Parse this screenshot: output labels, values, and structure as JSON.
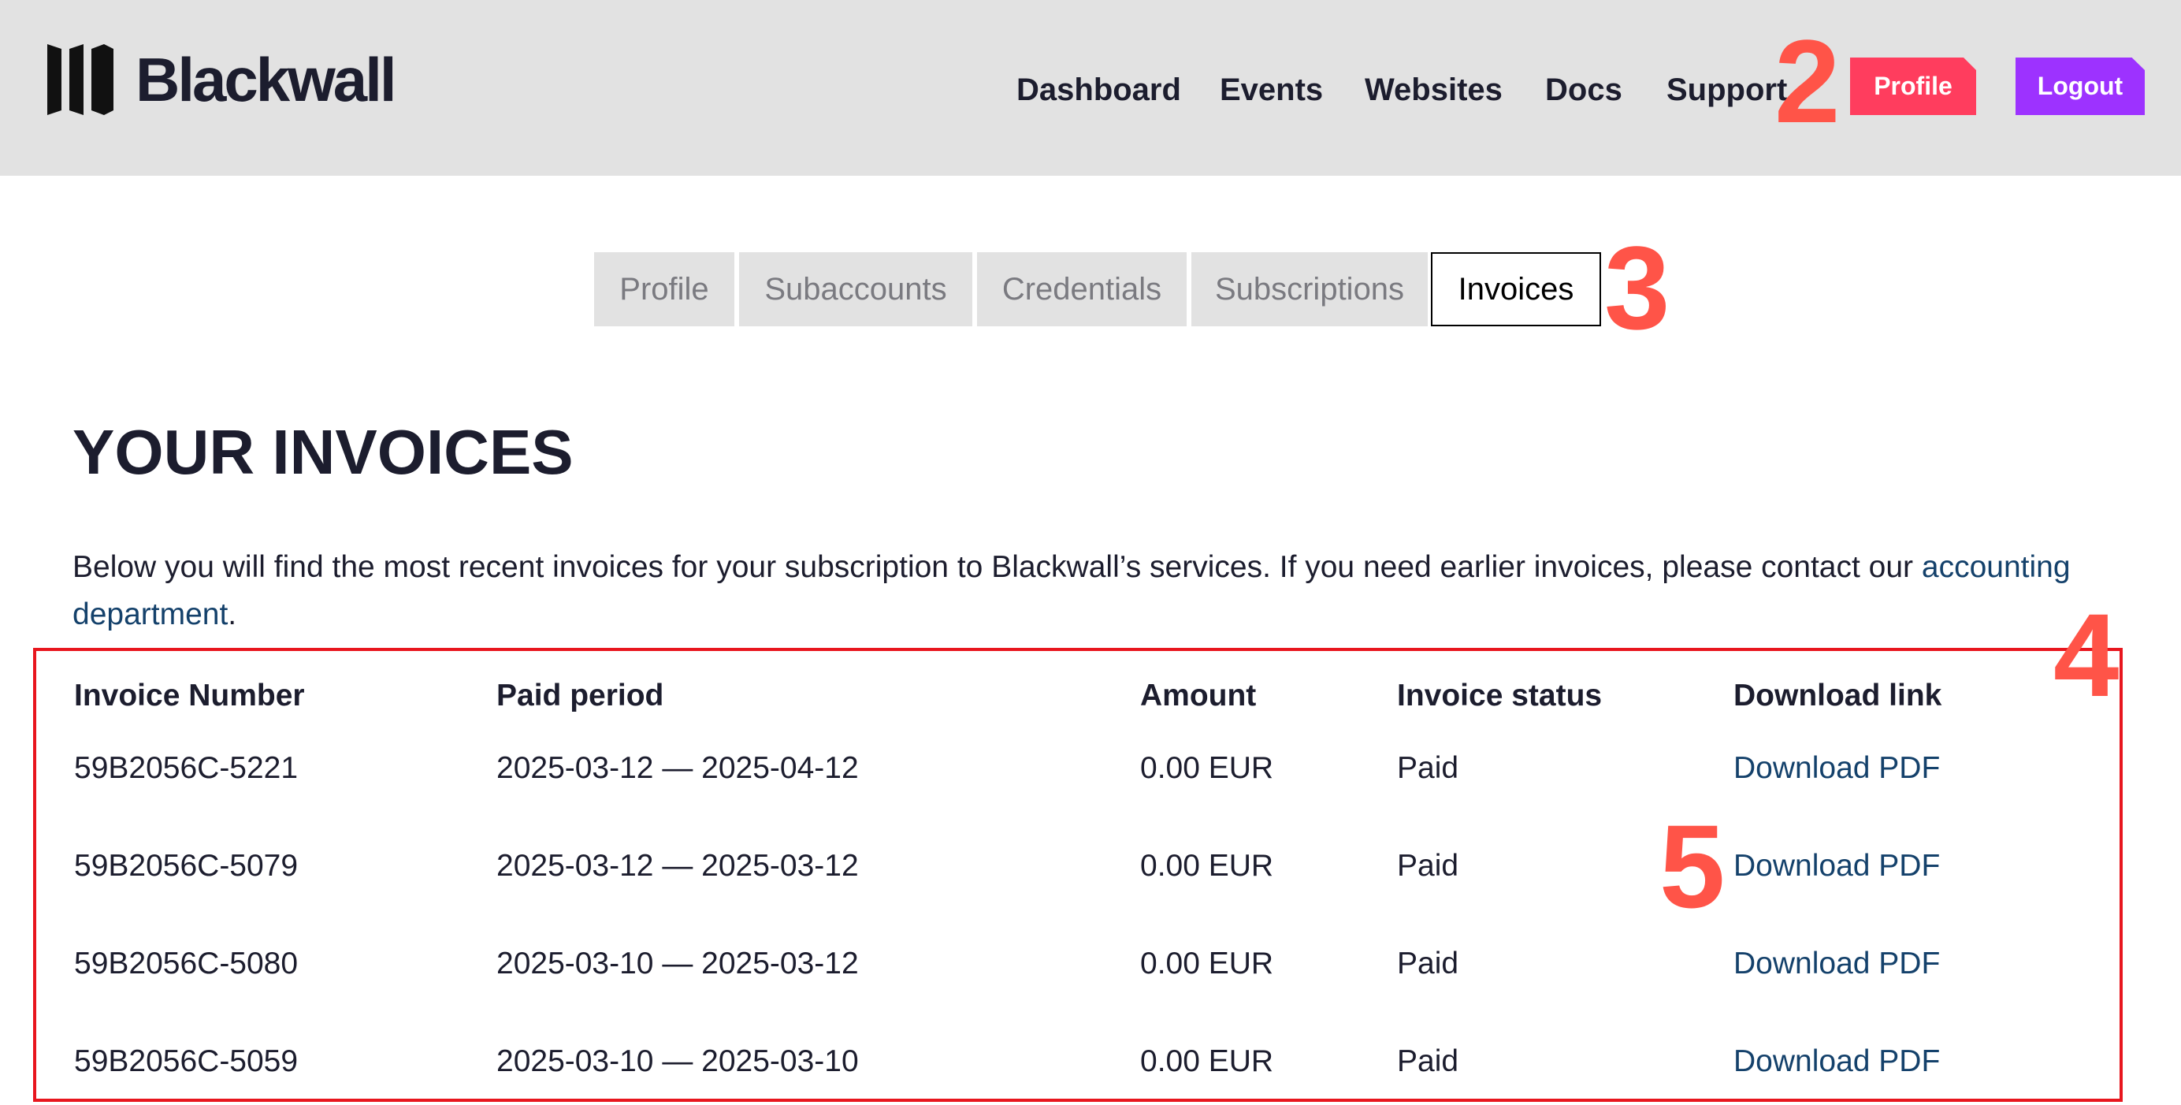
{
  "app": {
    "brand": "Blackwall"
  },
  "nav": {
    "items": [
      "Dashboard",
      "Events",
      "Websites",
      "Docs",
      "Support"
    ],
    "profile_label": "Profile",
    "logout_label": "Logout"
  },
  "tabs": [
    "Profile",
    "Subaccounts",
    "Credentials",
    "Subscriptions",
    "Invoices"
  ],
  "active_tab": "Invoices",
  "page": {
    "title": "YOUR INVOICES",
    "intro_text": "Below you will find the most recent invoices for your subscription to Blackwall’s services. If you need earlier invoices, please contact our ",
    "intro_link": "accounting department",
    "intro_end": "."
  },
  "table": {
    "headers": [
      "Invoice Number",
      "Paid period",
      "Amount",
      "Invoice status",
      "Download link"
    ],
    "rows": [
      [
        "59B2056C-5221",
        "2025-03-12 — 2025-04-12",
        "0.00 EUR",
        "Paid",
        "Download PDF"
      ],
      [
        "59B2056C-5079",
        "2025-03-12 — 2025-03-12",
        "0.00 EUR",
        "Paid",
        "Download PDF"
      ],
      [
        "59B2056C-5080",
        "2025-03-10 — 2025-03-12",
        "0.00 EUR",
        "Paid",
        "Download PDF"
      ],
      [
        "59B2056C-5059",
        "2025-03-10 — 2025-03-10",
        "0.00 EUR",
        "Paid",
        "Download PDF"
      ]
    ]
  },
  "annotations": [
    "2",
    "3",
    "4",
    "5"
  ],
  "colors": {
    "header_bg": "#e2e2e2",
    "profile_button": "#ff3d5e",
    "logout_button": "#9d32ff",
    "link": "#14416b",
    "annotation": "#ff5448",
    "highlight_border": "#e8161e"
  }
}
